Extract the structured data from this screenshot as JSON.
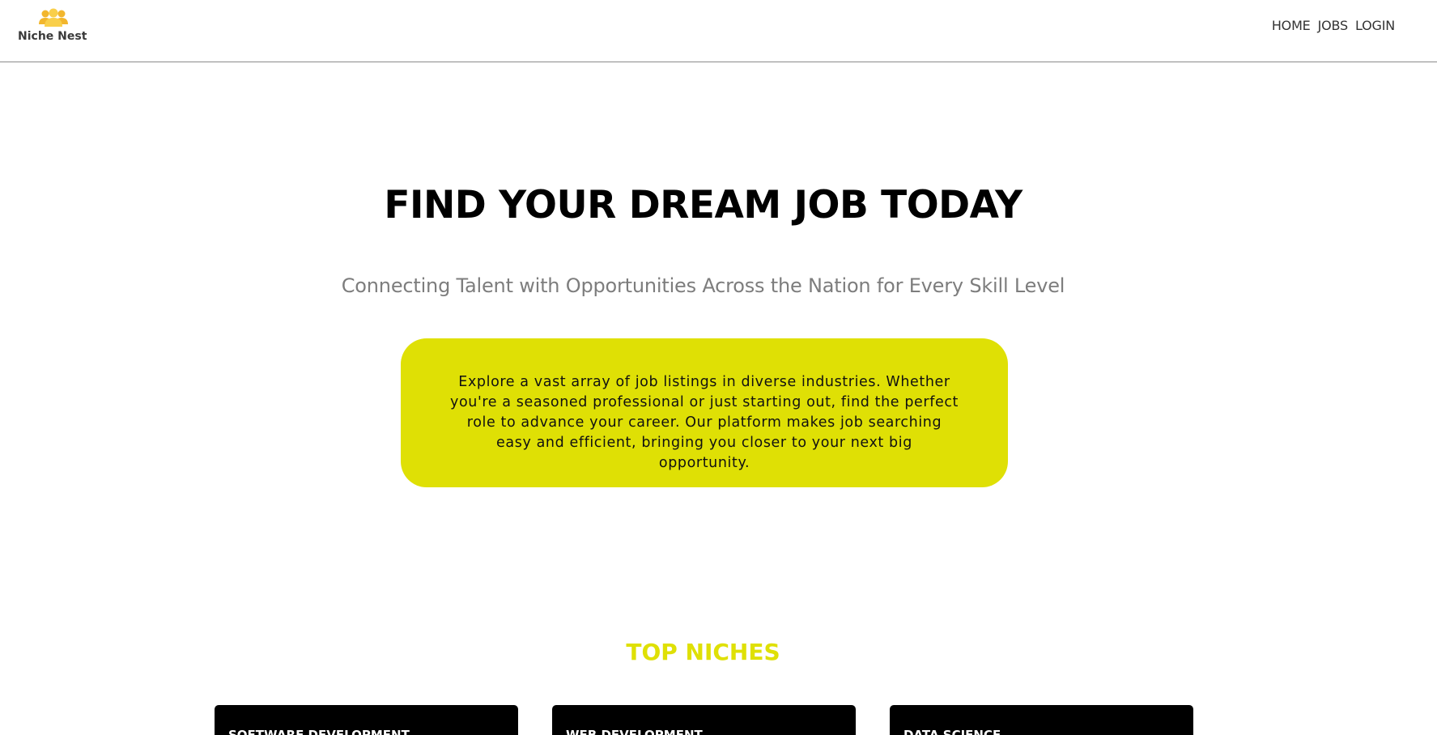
{
  "header": {
    "logo_text": "Niche Nest",
    "logo_icon": "group-people-icon",
    "nav": [
      {
        "label": "HOME"
      },
      {
        "label": "JOBS"
      },
      {
        "label": "LOGIN"
      }
    ]
  },
  "hero": {
    "title": "FIND YOUR DREAM JOB TODAY",
    "subtitle": "Connecting Talent with Opportunities Across the Nation for Every Skill Level",
    "intro": "Explore a vast array of job listings in diverse industries. Whether you're a seasoned professional or just starting out, find the perfect role to advance your career. Our platform makes job searching easy and efficient, bringing you closer to your next big opportunity."
  },
  "niches": {
    "title": "TOP NICHES",
    "items": [
      {
        "label": "SOFTWARE DEVELOPMENT"
      },
      {
        "label": "WEB DEVELOPMENT"
      },
      {
        "label": "DATA SCIENCE"
      }
    ]
  },
  "colors": {
    "accent": "#dfe005",
    "logo": "#f7c53a",
    "card": "#000000",
    "subtitle": "#7d7d7d"
  }
}
